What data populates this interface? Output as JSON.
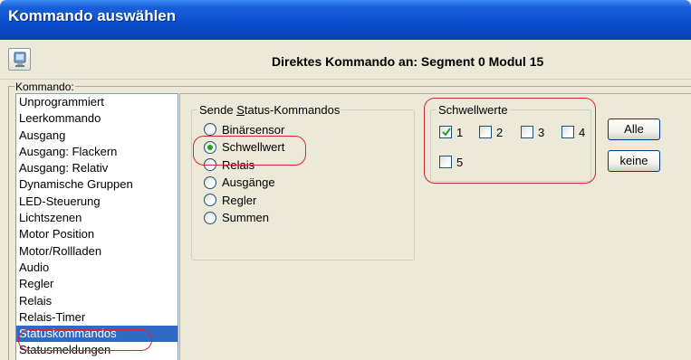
{
  "window": {
    "title": "Kommando auswählen"
  },
  "header": {
    "text": "Direktes Kommando an: Segment 0 Modul 15"
  },
  "kommando": {
    "label": "Kommando:",
    "items": [
      "Unprogrammiert",
      "Leerkommando",
      "Ausgang",
      "Ausgang: Flackern",
      "Ausgang: Relativ",
      "Dynamische Gruppen",
      "LED-Steuerung",
      "Lichtszenen",
      "Motor Position",
      "Motor/Rollladen",
      "Audio",
      "Regler",
      "Relais",
      "Relais-Timer",
      "Statuskommandos",
      "Statusmeldungen"
    ],
    "selected": "Statuskommandos"
  },
  "status": {
    "legend": "Sende Status-Kommandos",
    "options": [
      "Binärsensor",
      "Schwellwert",
      "Relais",
      "Ausgänge",
      "Regler",
      "Summen"
    ],
    "selected": "Schwellwert"
  },
  "schwellwerte": {
    "legend": "Schwellwerte",
    "items": [
      {
        "label": "1",
        "checked": true
      },
      {
        "label": "2",
        "checked": false
      },
      {
        "label": "3",
        "checked": false
      },
      {
        "label": "4",
        "checked": false
      },
      {
        "label": "5",
        "checked": false
      }
    ]
  },
  "buttons": {
    "all_label": "Alle",
    "none_label": "keine"
  },
  "icons": {
    "header_button": "monitor-icon"
  },
  "colors": {
    "title_bar": "#0a4fd0",
    "selection": "#316ac5",
    "highlight": "#d9262c",
    "radio_dot": "#21a121"
  }
}
